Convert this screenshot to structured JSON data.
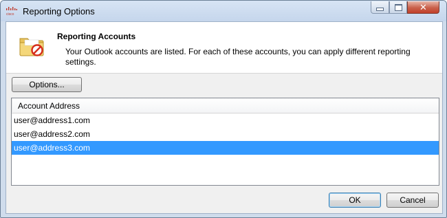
{
  "window": {
    "title": "Reporting Options",
    "app_icon": "cisco-logo-icon",
    "controls": {
      "minimize": "minimize-icon",
      "maximize": "maximize-icon",
      "close": "close-icon"
    }
  },
  "header": {
    "icon": "folder-no-entry-icon",
    "title": "Reporting Accounts",
    "description": "Your Outlook accounts are listed. For each of these accounts, you can apply different reporting settings."
  },
  "toolbar": {
    "options_label": "Options..."
  },
  "accounts": {
    "column_header": "Account Address",
    "rows": [
      {
        "address": "user@address1.com",
        "selected": false
      },
      {
        "address": "user@address2.com",
        "selected": false
      },
      {
        "address": "user@address3.com",
        "selected": true
      }
    ]
  },
  "footer": {
    "ok_label": "OK",
    "cancel_label": "Cancel"
  },
  "colors": {
    "selection": "#3399ff",
    "close_button": "#c9604a"
  }
}
